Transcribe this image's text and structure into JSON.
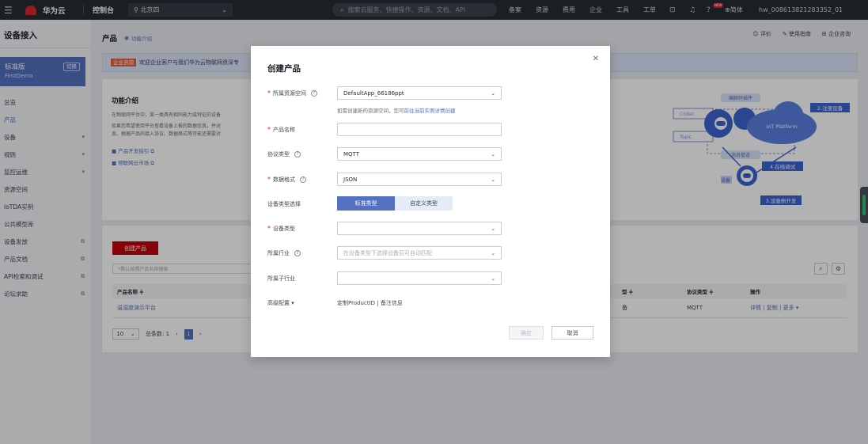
{
  "topbar": {
    "brand_small": "HUAWEI",
    "brand": "华为云",
    "console": "控制台",
    "region": "北京四",
    "search_placeholder": "搜索云服务、快捷操作、资源、文档、API",
    "nav": [
      "备案",
      "资源",
      "费用",
      "企业",
      "工具",
      "工单"
    ],
    "new_badge": "NEW",
    "lang": "简体",
    "username": "hw_008613821283352_01"
  },
  "sidebar": {
    "title": "设备接入",
    "edition": "标准版",
    "instance": "FirstDemo",
    "switch_label": "切换",
    "items": [
      {
        "label": "总览",
        "icon": ""
      },
      {
        "label": "产品",
        "icon": ""
      },
      {
        "label": "设备",
        "icon": "▾"
      },
      {
        "label": "规则",
        "icon": "▾"
      },
      {
        "label": "监控运维",
        "icon": "▾"
      },
      {
        "label": "资源空间",
        "icon": ""
      },
      {
        "label": "IoTDA实例",
        "icon": ""
      },
      {
        "label": "公共模型库",
        "icon": ""
      },
      {
        "label": "设备发放",
        "icon": "⧉"
      },
      {
        "label": "产品文档",
        "icon": "⧉"
      },
      {
        "label": "API检索和调试",
        "icon": "⧉"
      },
      {
        "label": "论坛求助",
        "icon": "⧉"
      }
    ]
  },
  "page": {
    "title": "产品",
    "function_link": "功能介绍",
    "links": [
      "评价",
      "使用指南",
      "企业咨询"
    ],
    "notice_tag": "企业咨询",
    "notice_text": "欢迎企业客户与我们华为云物联网资深专",
    "intro_title": "功能介绍",
    "intro_lines": [
      "在物联网平台中，某一类具有相同能力或特征的设备",
      "如果您希望使用平台查看设备上报的数据信息，并对",
      "息。根据产品的接入协议、数据格式等可能还需要对"
    ],
    "intro_links": [
      "产品开发指引 ⧉",
      "物联网云市场 ⧉"
    ],
    "diagram": {
      "codec_plugin": "编解码插件",
      "codec": "Codec",
      "topic": "Topic",
      "msg_pipe": "消息管道",
      "platform": "IoT Platform",
      "step2": "2.注册设备",
      "step3": "3.设备侧开发",
      "step4": "4.在线调试",
      "device": "设备"
    },
    "create_button": "创建产品",
    "search_placeholder": "默认按照产品名称搜索",
    "table": {
      "headers": [
        "产品名称 ≑",
        "型 ≑",
        "协议类型 ≑",
        "操作"
      ],
      "row": {
        "name": "温湿度演示平台",
        "type": "备",
        "protocol": "MQTT",
        "ops": "详情 | 复制 | 更多 ▾"
      }
    },
    "pager": {
      "size": "10",
      "total": "总条数: 1",
      "current": "1"
    }
  },
  "modal": {
    "title": "创建产品",
    "fields": {
      "space": {
        "label": "所属资源空间",
        "value": "DefaultApp_66186ppt"
      },
      "hint": "如需创建新的资源空间，您可",
      "hint_link": "前往当前实例详情创建",
      "name": {
        "label": "产品名称",
        "value": ""
      },
      "protocol": {
        "label": "协议类型",
        "value": "MQTT"
      },
      "format": {
        "label": "数据格式",
        "value": "JSON"
      },
      "type_select": {
        "label": "设备类型选择",
        "standard": "标准类型",
        "custom": "自定义类型"
      },
      "device_type": {
        "label": "设备类型",
        "value": ""
      },
      "industry": {
        "label": "所属行业",
        "placeholder": "在设备类型下选择设备后可自动匹配"
      },
      "sub_industry": {
        "label": "所属子行业",
        "value": ""
      },
      "advanced": {
        "label": "高级配置 ▾",
        "text": "定制ProductID | 备注信息"
      }
    },
    "ok": "确定",
    "cancel": "取消"
  }
}
